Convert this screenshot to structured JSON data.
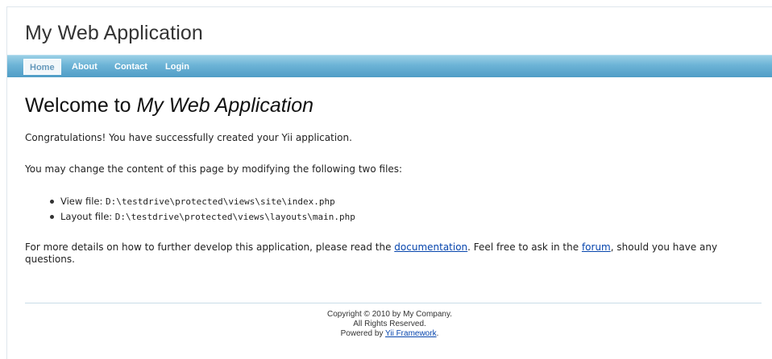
{
  "header": {
    "logo": "My Web Application"
  },
  "menu": {
    "items": [
      {
        "label": "Home",
        "active": true
      },
      {
        "label": "About",
        "active": false
      },
      {
        "label": "Contact",
        "active": false
      },
      {
        "label": "Login",
        "active": false
      }
    ]
  },
  "main": {
    "heading_prefix": "Welcome to ",
    "heading_app": "My Web Application",
    "congrats": "Congratulations! You have successfully created your Yii application.",
    "change_intro": "You may change the content of this page by modifying the following two files:",
    "files": [
      {
        "label": "View file: ",
        "path": "D:\\testdrive\\protected\\views\\site\\index.php"
      },
      {
        "label": "Layout file: ",
        "path": "D:\\testdrive\\protected\\views\\layouts\\main.php"
      }
    ],
    "more_1": "For more details on how to further develop this application, please read the ",
    "doc_link": "documentation",
    "more_2": ". Feel free to ask in the ",
    "forum_link": "forum",
    "more_3": ", should you have any questions."
  },
  "footer": {
    "copyright": "Copyright © 2010 by My Company.",
    "rights": "All Rights Reserved.",
    "powered_prefix": "Powered by ",
    "framework_link": "Yii Framework",
    "powered_suffix": "."
  },
  "colors": {
    "menu_bar": "#6cb3d6",
    "link": "#0645ad",
    "active_tab_bg": "#f2f7fa"
  }
}
